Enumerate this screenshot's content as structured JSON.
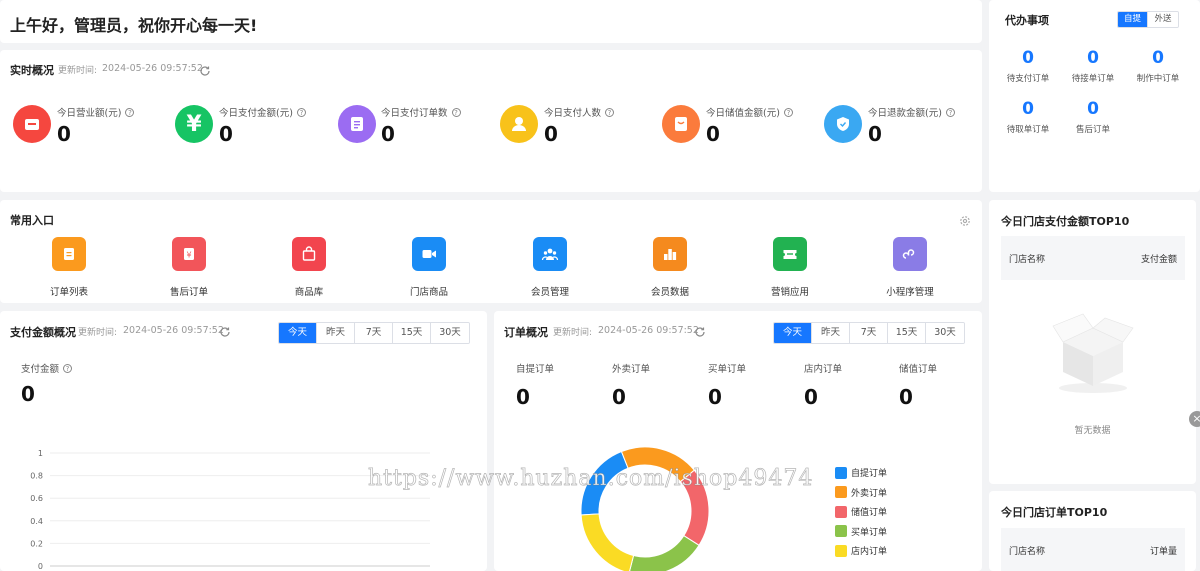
{
  "greeting": "上午好，管理员，祝你开心每一天!",
  "realtime": {
    "title": "实时概况",
    "update_prefix": "更新时间:",
    "update_time": "2024-05-26 09:57:52",
    "stats": [
      {
        "label": "今日营业额(元)",
        "value": "0",
        "icon": "cash-register-icon",
        "color": "#f5473f"
      },
      {
        "label": "今日支付金额(元)",
        "value": "0",
        "icon": "yen-icon",
        "color": "#16c464"
      },
      {
        "label": "今日支付订单数",
        "value": "0",
        "icon": "document-icon",
        "color": "#9b6cf2"
      },
      {
        "label": "今日支付人数",
        "value": "0",
        "icon": "user-icon",
        "color": "#f8c21a"
      },
      {
        "label": "今日储值金额(元)",
        "value": "0",
        "icon": "wallet-icon",
        "color": "#fb7b3c"
      },
      {
        "label": "今日退款金额(元)",
        "value": "0",
        "icon": "shield-icon",
        "color": "#3aa8f2"
      }
    ]
  },
  "todo": {
    "title": "代办事项",
    "toggle": [
      "自提",
      "外送"
    ],
    "items": [
      {
        "value": "0",
        "label": "待支付订单"
      },
      {
        "value": "0",
        "label": "待接单订单"
      },
      {
        "value": "0",
        "label": "制作中订单"
      },
      {
        "value": "0",
        "label": "待取单订单"
      },
      {
        "value": "0",
        "label": "售后订单"
      }
    ]
  },
  "shortcuts": {
    "title": "常用入口",
    "items": [
      {
        "label": "订单列表",
        "icon": "order-list-icon",
        "color": "#fb9a1e"
      },
      {
        "label": "售后订单",
        "icon": "after-sale-icon",
        "color": "#f2555a"
      },
      {
        "label": "商品库",
        "icon": "shopping-bag-icon",
        "color": "#f2454e"
      },
      {
        "label": "门店商品",
        "icon": "video-icon",
        "color": "#1a8cf5"
      },
      {
        "label": "会员管理",
        "icon": "members-icon",
        "color": "#1a8cf5"
      },
      {
        "label": "会员数据",
        "icon": "member-data-icon",
        "color": "#f58a1e"
      },
      {
        "label": "营销应用",
        "icon": "ticket-icon",
        "color": "#22b251"
      },
      {
        "label": "小程序管理",
        "icon": "miniprogram-icon",
        "color": "#8a7ce6"
      }
    ]
  },
  "payment": {
    "title": "支付金额概况",
    "update_prefix": "更新时间:",
    "update_time": "2024-05-26 09:57:52",
    "tabs": [
      "今天",
      "昨天",
      "7天",
      "15天",
      "30天"
    ],
    "metric_label": "支付金额",
    "metric_value": "0",
    "y_ticks": [
      "1",
      "0.8",
      "0.6",
      "0.4",
      "0.2",
      "0"
    ]
  },
  "orders": {
    "title": "订单概况",
    "update_prefix": "更新时间:",
    "update_time": "2024-05-26 09:57:52",
    "tabs": [
      "今天",
      "昨天",
      "7天",
      "15天",
      "30天"
    ],
    "types": [
      {
        "label": "自提订单",
        "value": "0"
      },
      {
        "label": "外卖订单",
        "value": "0"
      },
      {
        "label": "买单订单",
        "value": "0"
      },
      {
        "label": "店内订单",
        "value": "0"
      },
      {
        "label": "储值订单",
        "value": "0"
      }
    ]
  },
  "chart_data": {
    "type": "pie",
    "categories": [
      "自提订单",
      "外卖订单",
      "储值订单",
      "买单订单",
      "店内订单"
    ],
    "values": [
      1,
      1,
      1,
      1,
      1
    ],
    "colors": [
      "#1a8cf5",
      "#fb9a1e",
      "#f2666a",
      "#8bc34a",
      "#fadb24"
    ],
    "legend_position": "right"
  },
  "store_pay_top": {
    "title": "今日门店支付金额TOP10",
    "col_name": "门店名称",
    "col_value": "支付金额",
    "empty_text": "暂无数据"
  },
  "store_order_top": {
    "title": "今日门店订单TOP10",
    "col_name": "门店名称",
    "col_value": "订单量"
  },
  "watermark": "https://www.huzhan.com/ishop49474"
}
